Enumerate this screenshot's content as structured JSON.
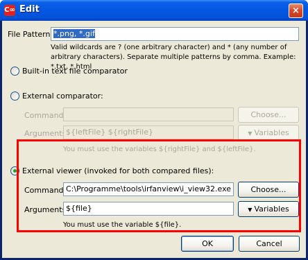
{
  "window": {
    "title": "Edit",
    "app_icon_text": "C∞",
    "close_glyph": "×"
  },
  "file_pattern": {
    "label": "File Pattern:",
    "value": "*.png, *.gif",
    "hint": "Valid wildcards are ? (one arbitrary character) and * (any number of arbitrary characters). Separate multiple patterns by comma. Example: *.txt, *.html"
  },
  "builtin": {
    "label": "Built-in text file comparator",
    "selected": false
  },
  "external_comparator": {
    "label": "External comparator:",
    "selected": false,
    "command_label": "Command:",
    "command_value": "",
    "choose_label": "Choose...",
    "arguments_label": "Arguments:",
    "arguments_value": "${leftFile} ${rightFile}",
    "variables_label": "Variables",
    "hint": "You must use the variables ${rightFile} and ${leftFile}."
  },
  "external_viewer": {
    "label": "External viewer (invoked for both compared files):",
    "selected": true,
    "command_label": "Command:",
    "command_value": "C:\\Programme\\tools\\irfanview\\i_view32.exe",
    "choose_label": "Choose...",
    "arguments_label": "Arguments:",
    "arguments_value": "${file}",
    "variables_label": "Variables",
    "hint": "You must use the variable ${file}."
  },
  "footer": {
    "ok_label": "OK",
    "cancel_label": "Cancel"
  },
  "colors": {
    "highlight": "#ff0000",
    "titlebar": "#0457e2",
    "dialog_bg": "#ece9d8"
  }
}
